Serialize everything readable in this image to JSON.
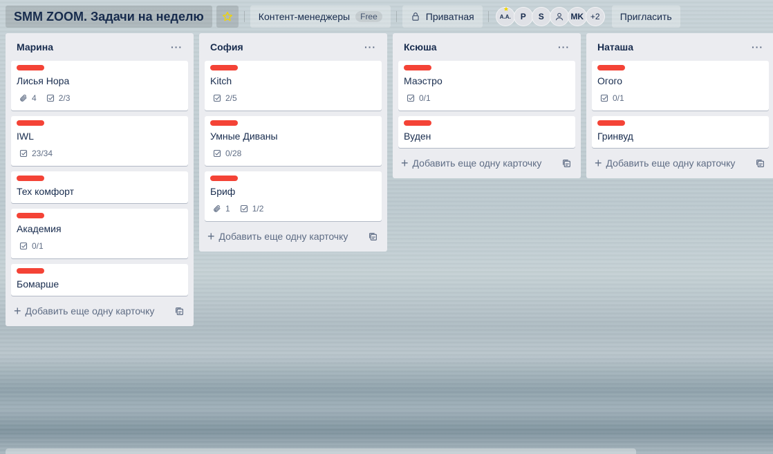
{
  "header": {
    "board_title": "SMM ZOOM. Задачи на неделю",
    "team_label": "Контент-менеджеры",
    "team_plan": "Free",
    "visibility_label": "Приватная",
    "members": [
      "A.A.",
      "P",
      "S",
      "",
      "MK"
    ],
    "extra_members": "+2",
    "invite_label": "Пригласить"
  },
  "colors": {
    "label": "#f44336",
    "list_bg": "#ebecf0",
    "star": "#f2d600"
  },
  "add_card_label": "Добавить еще одну карточку",
  "lists": [
    {
      "title": "Марина",
      "cards": [
        {
          "title": "Лисья Нора",
          "attachments": "4",
          "checklist": "2/3"
        },
        {
          "title": "IWL",
          "checklist": "23/34"
        },
        {
          "title": "Тех комфорт"
        },
        {
          "title": "Академия",
          "checklist": "0/1"
        },
        {
          "title": "Бомарше"
        }
      ]
    },
    {
      "title": "София",
      "cards": [
        {
          "title": "Kitch",
          "checklist": "2/5"
        },
        {
          "title": "Умные Диваны",
          "checklist": "0/28"
        },
        {
          "title": "Бриф",
          "attachments": "1",
          "checklist": "1/2"
        }
      ]
    },
    {
      "title": "Ксюша",
      "cards": [
        {
          "title": "Маэстро",
          "checklist": "0/1"
        },
        {
          "title": "Вуден"
        }
      ]
    },
    {
      "title": "Наташа",
      "cards": [
        {
          "title": "Огого",
          "checklist": "0/1"
        },
        {
          "title": "Гринвуд"
        }
      ]
    }
  ]
}
